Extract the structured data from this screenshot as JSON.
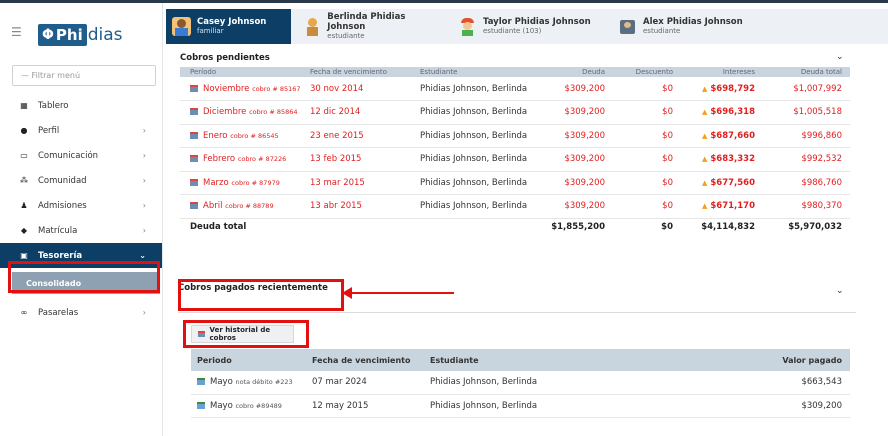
{
  "app": {
    "logo_symbol": "Φ",
    "logo_brand": "Phi",
    "logo_suffix": "dias",
    "menu_icon": "hamburger-icon"
  },
  "sidebar": {
    "filter_placeholder": "— Filtrar menú",
    "items": [
      {
        "label": "Tablero",
        "icon": "dashboard-icon",
        "chevron": ""
      },
      {
        "label": "Perfil",
        "icon": "person-icon",
        "chevron": "›"
      },
      {
        "label": "Comunicación",
        "icon": "message-icon",
        "chevron": "›"
      },
      {
        "label": "Comunidad",
        "icon": "community-icon",
        "chevron": "›"
      },
      {
        "label": "Admisiones",
        "icon": "admissions-icon",
        "chevron": "›"
      },
      {
        "label": "Matrícula",
        "icon": "graduation-cap-icon",
        "chevron": "›"
      },
      {
        "label": "Tesorería",
        "icon": "treasury-icon",
        "chevron": "⌄"
      },
      {
        "label": "Pasarelas",
        "icon": "link-icon",
        "chevron": "›"
      }
    ],
    "sub_item": "Consolidado"
  },
  "tabs": [
    {
      "name": "Casey Johnson",
      "role": "familiar"
    },
    {
      "name": "Berlinda Phidias Johnson",
      "role": "estudiante"
    },
    {
      "name": "Taylor Phidias Johnson",
      "role": "estudiante (103)"
    },
    {
      "name": "Alex Phidias Johnson",
      "role": "estudiante"
    }
  ],
  "pending": {
    "title": "Cobros pendientes",
    "headers": [
      "Período",
      "Fecha de vencimiento",
      "Estudiante",
      "Deuda",
      "Descuento",
      "Intereses",
      "Deuda total"
    ],
    "rows": [
      {
        "period": "Noviembre",
        "ref": "cobro # 85167",
        "due": "30 nov 2014",
        "student": "Phidias Johnson, Berlinda",
        "debt": "$309,200",
        "discount": "$0",
        "interest": "$698,792",
        "total": "$1,007,992"
      },
      {
        "period": "Diciembre",
        "ref": "cobro # 85864",
        "due": "12 dic 2014",
        "student": "Phidias Johnson, Berlinda",
        "debt": "$309,200",
        "discount": "$0",
        "interest": "$696,318",
        "total": "$1,005,518"
      },
      {
        "period": "Enero",
        "ref": "cobro # 86545",
        "due": "23 ene 2015",
        "student": "Phidias Johnson, Berlinda",
        "debt": "$309,200",
        "discount": "$0",
        "interest": "$687,660",
        "total": "$996,860"
      },
      {
        "period": "Febrero",
        "ref": "cobro # 87226",
        "due": "13 feb 2015",
        "student": "Phidias Johnson, Berlinda",
        "debt": "$309,200",
        "discount": "$0",
        "interest": "$683,332",
        "total": "$992,532"
      },
      {
        "period": "Marzo",
        "ref": "cobro # 87979",
        "due": "13 mar 2015",
        "student": "Phidias Johnson, Berlinda",
        "debt": "$309,200",
        "discount": "$0",
        "interest": "$677,560",
        "total": "$986,760"
      },
      {
        "period": "Abril",
        "ref": "cobro # 88789",
        "due": "13 abr 2015",
        "student": "Phidias Johnson, Berlinda",
        "debt": "$309,200",
        "discount": "$0",
        "interest": "$671,170",
        "total": "$980,370"
      }
    ],
    "total": {
      "label": "Deuda total",
      "debt": "$1,855,200",
      "discount": "$0",
      "interest": "$4,114,832",
      "total": "$5,970,032"
    }
  },
  "paid": {
    "title": "Cobros pagados recientemente",
    "history_button": "Ver historial de cobros",
    "headers": [
      "Periodo",
      "Fecha de vencimiento",
      "Estudiante",
      "Valor pagado"
    ],
    "rows": [
      {
        "period": "Mayo",
        "ref": "nota débito #223",
        "due": "07 mar 2024",
        "student": "Phidias Johnson, Berlinda",
        "paid": "$663,543"
      },
      {
        "period": "Mayo",
        "ref": "cobro #89489",
        "due": "12 may 2015",
        "student": "Phidias Johnson, Berlinda",
        "paid": "$309,200"
      }
    ]
  },
  "colors": {
    "accent": "#0d3f66",
    "alert": "#e02020",
    "highlight": "#e31010"
  }
}
